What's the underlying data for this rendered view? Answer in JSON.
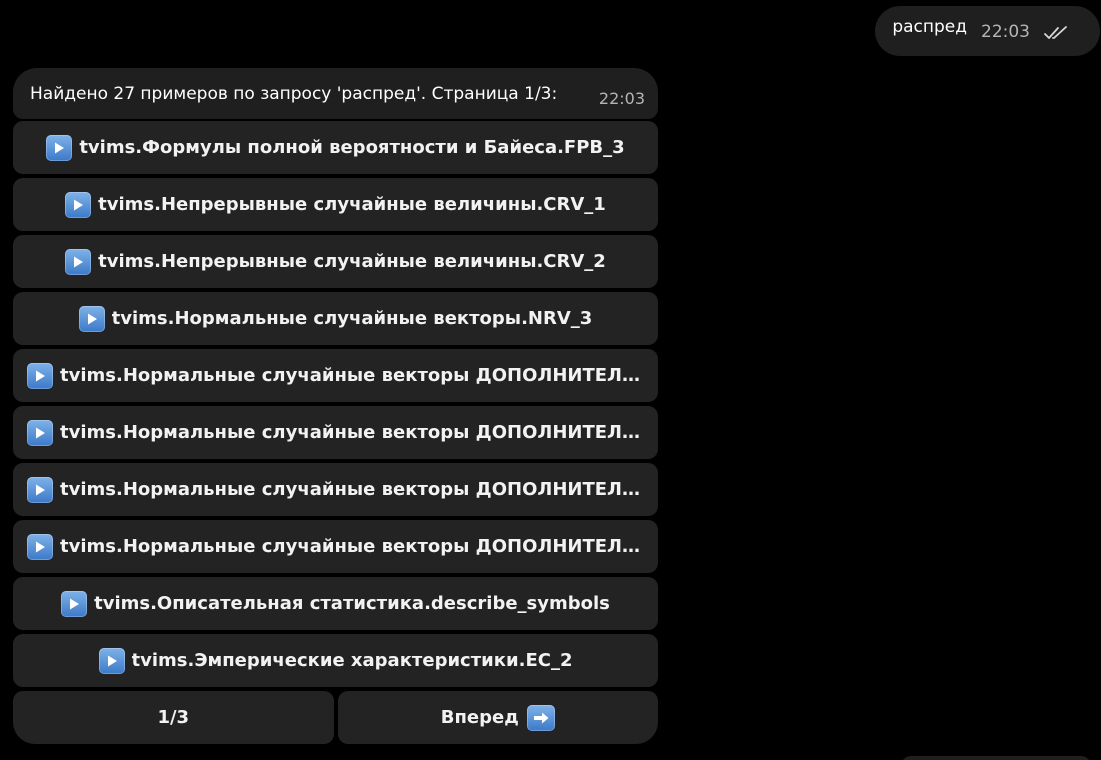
{
  "outgoing": {
    "text": "распред",
    "time": "22:03",
    "status_icon": "double-check-icon"
  },
  "incoming": {
    "text": "Найдено 27 примеров по запросу 'распред'. Страница 1/3:",
    "time": "22:03"
  },
  "keyboard": {
    "items": [
      {
        "label": "tvims.Формулы полной вероятности и Байеса.FPB_3",
        "icon": "play-icon"
      },
      {
        "label": "tvims.Непрерывные случайные величины.CRV_1",
        "icon": "play-icon"
      },
      {
        "label": "tvims.Непрерывные случайные величины.CRV_2",
        "icon": "play-icon"
      },
      {
        "label": "tvims.Нормальные случайные векторы.NRV_3",
        "icon": "play-icon"
      },
      {
        "label": "tvims.Нормальные случайные векторы ДОПОЛНИТЕЛЬНЫ...",
        "icon": "play-icon"
      },
      {
        "label": "tvims.Нормальные случайные векторы ДОПОЛНИТЕЛЬНЫ...",
        "icon": "play-icon"
      },
      {
        "label": "tvims.Нормальные случайные векторы ДОПОЛНИТЕЛЬНЫ...",
        "icon": "play-icon"
      },
      {
        "label": "tvims.Нормальные случайные векторы ДОПОЛНИТЕЛЬНЫ...",
        "icon": "play-icon"
      },
      {
        "label": "tvims.Описательная статистика.describe_symbols",
        "icon": "play-icon"
      },
      {
        "label": "tvims.Эмперические характеристики.EC_2",
        "icon": "play-icon"
      }
    ],
    "page_indicator": "1/3",
    "next_label": "Вперед",
    "next_icon": "right-arrow-icon"
  },
  "colors": {
    "background": "#000000",
    "bubble": "#1f1f1f",
    "button": "#232323",
    "muted_text": "#b5b5b5",
    "icon_blue": "#4a8ad6"
  }
}
